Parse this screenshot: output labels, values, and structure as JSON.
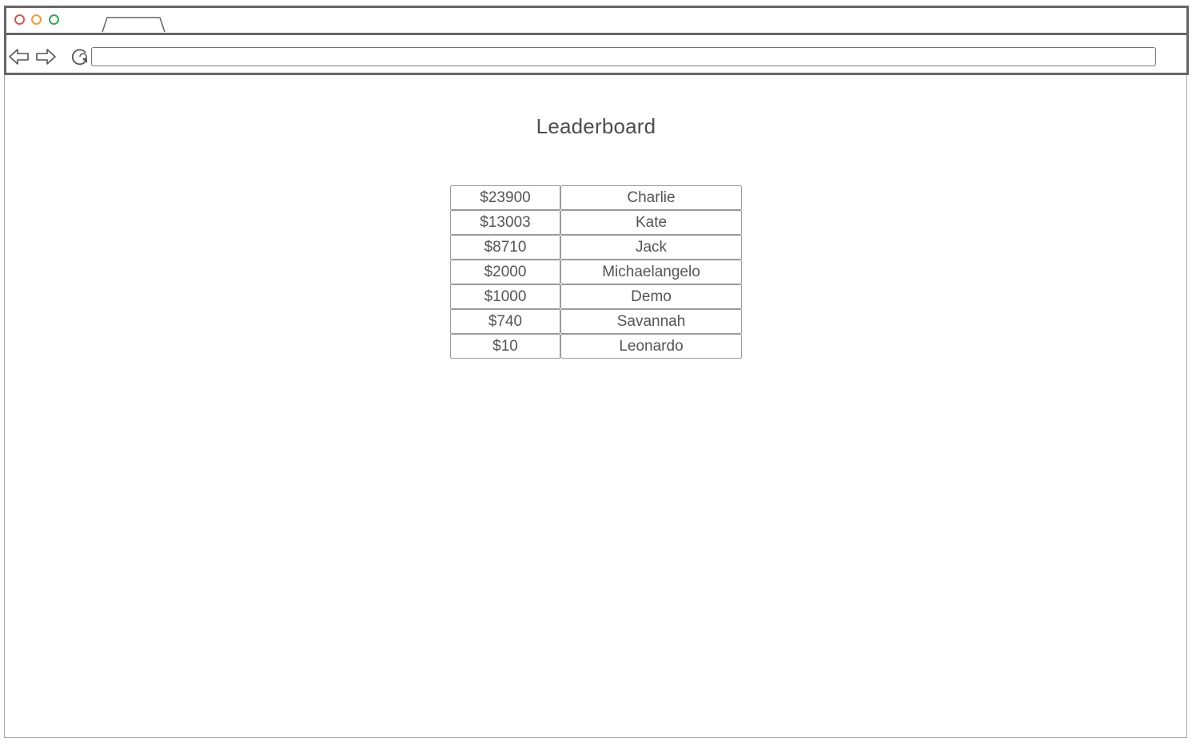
{
  "browser": {
    "window_buttons": [
      {
        "name": "close",
        "color": "#d9534f"
      },
      {
        "name": "minimize",
        "color": "#e8a13a"
      },
      {
        "name": "maximize",
        "color": "#3aa655"
      }
    ],
    "address_bar": {
      "value": "",
      "placeholder": ""
    }
  },
  "page": {
    "title": "Leaderboard",
    "leaderboard": [
      {
        "amount": "$23900",
        "name": "Charlie"
      },
      {
        "amount": "$13003",
        "name": "Kate"
      },
      {
        "amount": "$8710",
        "name": "Jack"
      },
      {
        "amount": "$2000",
        "name": "Michaelangelo"
      },
      {
        "amount": "$1000",
        "name": "Demo"
      },
      {
        "amount": "$740",
        "name": "Savannah"
      },
      {
        "amount": "$10",
        "name": "Leonardo"
      }
    ]
  }
}
